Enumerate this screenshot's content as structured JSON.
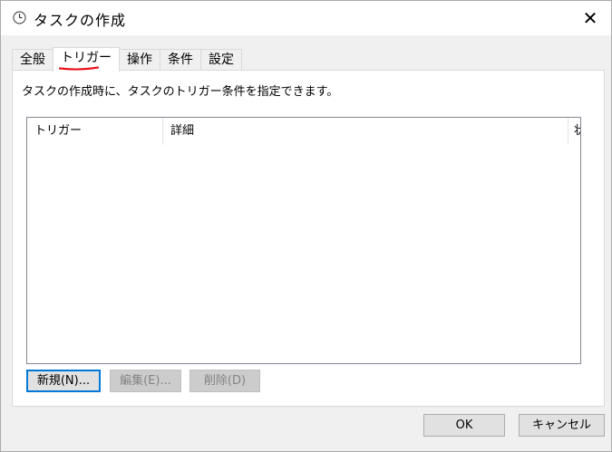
{
  "window": {
    "title": "タスクの作成",
    "close_symbol": "✕"
  },
  "tabs": [
    {
      "label": "全般"
    },
    {
      "label": "トリガー"
    },
    {
      "label": "操作"
    },
    {
      "label": "条件"
    },
    {
      "label": "設定"
    }
  ],
  "triggers_tab": {
    "description": "タスクの作成時に、タスクのトリガー条件を指定できます。",
    "columns": [
      "トリガー",
      "詳細",
      "状"
    ],
    "new_button": "新規(N)...",
    "edit_button": "編集(E)...",
    "delete_button": "削除(D)"
  },
  "footer": {
    "ok_button": "OK",
    "cancel_button": "キャンセル"
  },
  "annotation": {
    "color": "#e8131a"
  }
}
